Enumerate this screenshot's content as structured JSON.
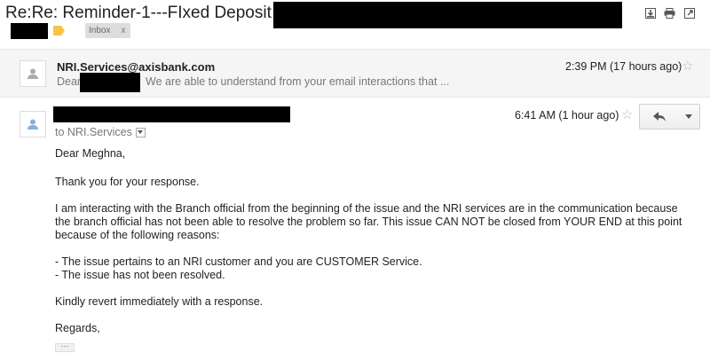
{
  "header": {
    "subject": "Re:Re: Reminder-1---FIxed Deposit No",
    "icons": [
      "download-icon",
      "print-icon",
      "new-window-icon"
    ],
    "inbox_label": "Inbox",
    "inbox_remove": "x"
  },
  "message1": {
    "sender": "NRI.Services@axisbank.com",
    "snippet_prefix": "Dear",
    "snippet": "We are able to understand from your email interactions that ...",
    "time": "2:39 PM (17 hours ago)",
    "star": "☆"
  },
  "message2": {
    "time": "6:41 AM (1 hour ago)",
    "star": "☆",
    "to": "to NRI.Services",
    "greeting": "Dear Meghna,",
    "thanks": "Thank you for your response.",
    "main": "I am interacting with the Branch official from the beginning of the issue and the NRI services are in the communication because the branch official has not been able to resolve the problem so far. This issue CAN NOT be closed from YOUR END at this point because of the following reasons:",
    "bullet1": "- The issue pertains to an NRI customer and you are CUSTOMER Service.",
    "bullet2": "- The issue has not been resolved.",
    "revert": "Kindly revert immediately with a response.",
    "regards": "Regards,",
    "ellipsis": "···"
  },
  "colors": {
    "label_yellow": "#f5c542",
    "redaction": "#000000"
  }
}
